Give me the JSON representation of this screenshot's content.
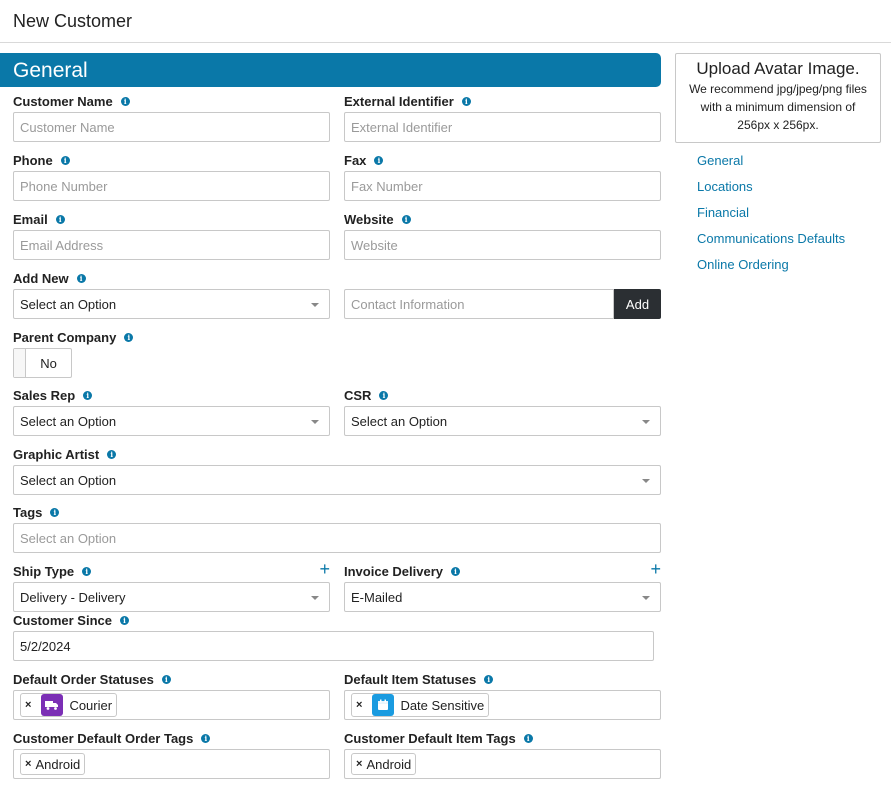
{
  "header": {
    "title": "New Customer"
  },
  "section": {
    "title": "General"
  },
  "fields": {
    "customer_name": {
      "label": "Customer Name",
      "placeholder": "Customer Name"
    },
    "external_identifier": {
      "label": "External Identifier",
      "placeholder": "External Identifier"
    },
    "phone": {
      "label": "Phone",
      "placeholder": "Phone Number"
    },
    "fax": {
      "label": "Fax",
      "placeholder": "Fax Number"
    },
    "email": {
      "label": "Email",
      "placeholder": "Email Address"
    },
    "website": {
      "label": "Website",
      "placeholder": "Website"
    },
    "add_new": {
      "label": "Add New",
      "value": "Select an Option",
      "contact_placeholder": "Contact Information",
      "button": "Add"
    },
    "parent_company": {
      "label": "Parent Company",
      "value": "No"
    },
    "sales_rep": {
      "label": "Sales Rep",
      "value": "Select an Option"
    },
    "csr": {
      "label": "CSR",
      "value": "Select an Option"
    },
    "graphic_artist": {
      "label": "Graphic Artist",
      "value": "Select an Option"
    },
    "tags": {
      "label": "Tags",
      "placeholder": "Select an Option"
    },
    "ship_type": {
      "label": "Ship Type",
      "value": "Delivery - Delivery"
    },
    "invoice_delivery": {
      "label": "Invoice Delivery",
      "value": "E-Mailed"
    },
    "customer_since": {
      "label": "Customer Since",
      "value": "5/2/2024"
    },
    "default_order_statuses": {
      "label": "Default Order Statuses",
      "chips": [
        {
          "label": "Courier",
          "icon": "truck-icon",
          "color": "#7b2fb5"
        }
      ]
    },
    "default_item_statuses": {
      "label": "Default Item Statuses",
      "chips": [
        {
          "label": "Date Sensitive",
          "icon": "calendar-icon",
          "color": "#1a9be0"
        }
      ]
    },
    "customer_default_order_tags": {
      "label": "Customer Default Order Tags",
      "chips": [
        {
          "label": "Android"
        }
      ]
    },
    "customer_default_item_tags": {
      "label": "Customer Default Item Tags",
      "chips": [
        {
          "label": "Android"
        }
      ]
    }
  },
  "sidebar": {
    "avatar_title": "Upload Avatar Image.",
    "avatar_desc": "We recommend jpg/jpeg/png files with a minimum dimension of 256px x 256px.",
    "nav": [
      "General",
      "Locations",
      "Financial",
      "Communications Defaults",
      "Online Ordering"
    ]
  },
  "colors": {
    "accent": "#0a78a8",
    "add_button": "#2b2f33"
  }
}
